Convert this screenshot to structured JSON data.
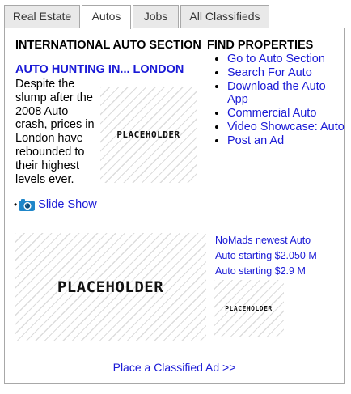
{
  "tabs": [
    {
      "label": "Real Estate",
      "active": false
    },
    {
      "label": "Autos",
      "active": true
    },
    {
      "label": "Jobs",
      "active": false
    },
    {
      "label": "All Classifieds",
      "active": false
    }
  ],
  "section": {
    "left_heading": "INTERNATIONAL AUTO SECTION",
    "right_heading": "FIND PROPERTIES"
  },
  "story": {
    "headline": "AUTO HUNTING IN... LONDON",
    "body": "Despite the slump after the 2008 Auto crash, prices in London have rebounded to their highest levels ever.",
    "image_text": "PLACEHOLDER",
    "slideshow_label": "Slide Show",
    "slideshow_icon": "camera-icon"
  },
  "find_links": [
    "Go to Auto Section",
    "Search For Auto",
    "Download the Auto App",
    "Commercial Auto",
    "Video Showcase: Auto",
    "Post an Ad"
  ],
  "promo": {
    "large_image_text": "PLACEHOLDER",
    "small_image_text": "PLACEHOLDER",
    "links": [
      "NoMads newest Auto",
      "Auto starting $2.050 M",
      "Auto starting $2.9 M"
    ]
  },
  "footer": {
    "classified_link": "Place a Classified Ad >>"
  },
  "colors": {
    "link": "#1a1ad6",
    "border": "#a8a8a8",
    "tab_inactive_bg": "#e9e9e9"
  }
}
